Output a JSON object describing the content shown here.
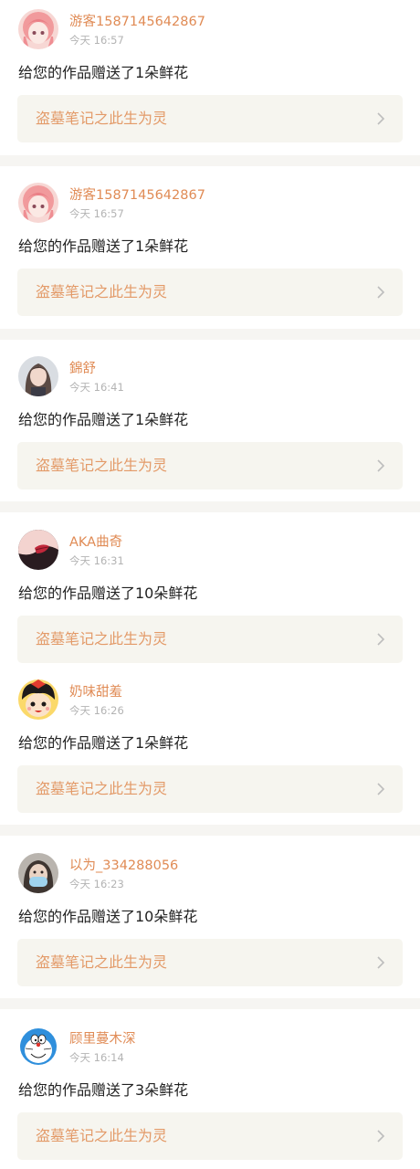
{
  "notifications": [
    {
      "name": "游客1587145642867",
      "time": "今天 16:57",
      "message": "给您的作品赠送了1朵鲜花",
      "work_title": "盗墓笔记之此生为灵",
      "avatar": "anime-girl-pink"
    },
    {
      "name": "游客1587145642867",
      "time": "今天 16:57",
      "message": "给您的作品赠送了1朵鲜花",
      "work_title": "盗墓笔记之此生为灵",
      "avatar": "anime-girl-pink"
    },
    {
      "name": "錦舒",
      "time": "今天 16:41",
      "message": "给您的作品赠送了1朵鲜花",
      "work_title": "盗墓笔记之此生为灵",
      "avatar": "portrait-girl"
    },
    {
      "name": "AKA曲奇",
      "time": "今天 16:31",
      "message": "给您的作品赠送了10朵鲜花",
      "work_title": "盗墓笔记之此生为灵",
      "avatar": "lips-closeup"
    },
    {
      "name": "奶味甜羞",
      "time": "今天 16:26",
      "message": "给您的作品赠送了1朵鲜花",
      "work_title": "盗墓笔记之此生为灵",
      "avatar": "cartoon-kid-yellow"
    },
    {
      "name": "以为_334288056",
      "time": "今天 16:23",
      "message": "给您的作品赠送了10朵鲜花",
      "work_title": "盗墓笔记之此生为灵",
      "avatar": "masked-face"
    },
    {
      "name": "顾里蔓木深",
      "time": "今天 16:14",
      "message": "给您的作品赠送了3朵鲜花",
      "work_title": "盗墓笔记之此生为灵",
      "avatar": "doraemon"
    }
  ],
  "colors": {
    "name": "#e08b55",
    "time": "#b3b3b3",
    "message": "#222222",
    "work_bg": "#f6f5ef",
    "work_title": "#e39a68",
    "separator": "#f6f5f2"
  }
}
